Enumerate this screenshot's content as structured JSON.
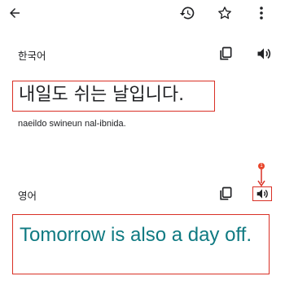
{
  "toolbar": {
    "back_icon": "arrow-left-icon",
    "history_icon": "history-icon",
    "star_icon": "star-outline-icon",
    "menu_icon": "more-vert-icon"
  },
  "source": {
    "language": "한국어",
    "text": "내일도 쉬는 날입니다.",
    "romanization": "naeildo swineun nal-ibnida.",
    "copy_icon": "copy-icon",
    "speaker_icon": "speaker-icon"
  },
  "target": {
    "language": "영어",
    "text": "Tomorrow is also a day off.",
    "copy_icon": "copy-icon",
    "speaker_icon": "speaker-icon"
  },
  "annotation": {
    "marker_label": "1"
  },
  "colors": {
    "highlight": "#d93025",
    "target_text": "#0f7a82",
    "icon": "#202124"
  }
}
